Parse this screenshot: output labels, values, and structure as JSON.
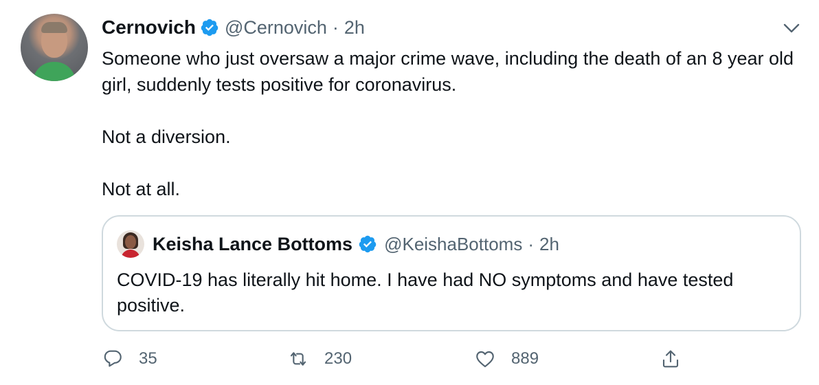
{
  "tweet": {
    "author_name": "Cernovich",
    "handle": "@Cernovich",
    "separator": "·",
    "time": "2h",
    "body": [
      "Someone who just oversaw a major crime wave, including the death of an 8 year old girl, suddenly tests positive for coronavirus.",
      "Not a diversion.",
      "Not at all."
    ]
  },
  "quote": {
    "author_name": "Keisha Lance Bottoms",
    "handle": "@KeishaBottoms",
    "separator": "·",
    "time": "2h",
    "text": "COVID-19 has literally hit home. I have had NO symptoms and have tested positive."
  },
  "actions": {
    "reply_count": "35",
    "retweet_count": "230",
    "like_count": "889"
  },
  "colors": {
    "verified": "#1d9bf0",
    "muted_text": "#536471",
    "border": "#cfd9de"
  },
  "icons": {
    "verified": "verified-badge-icon",
    "more": "chevron-down-icon",
    "reply": "reply-icon",
    "retweet": "retweet-icon",
    "like": "heart-icon",
    "share": "share-icon"
  }
}
